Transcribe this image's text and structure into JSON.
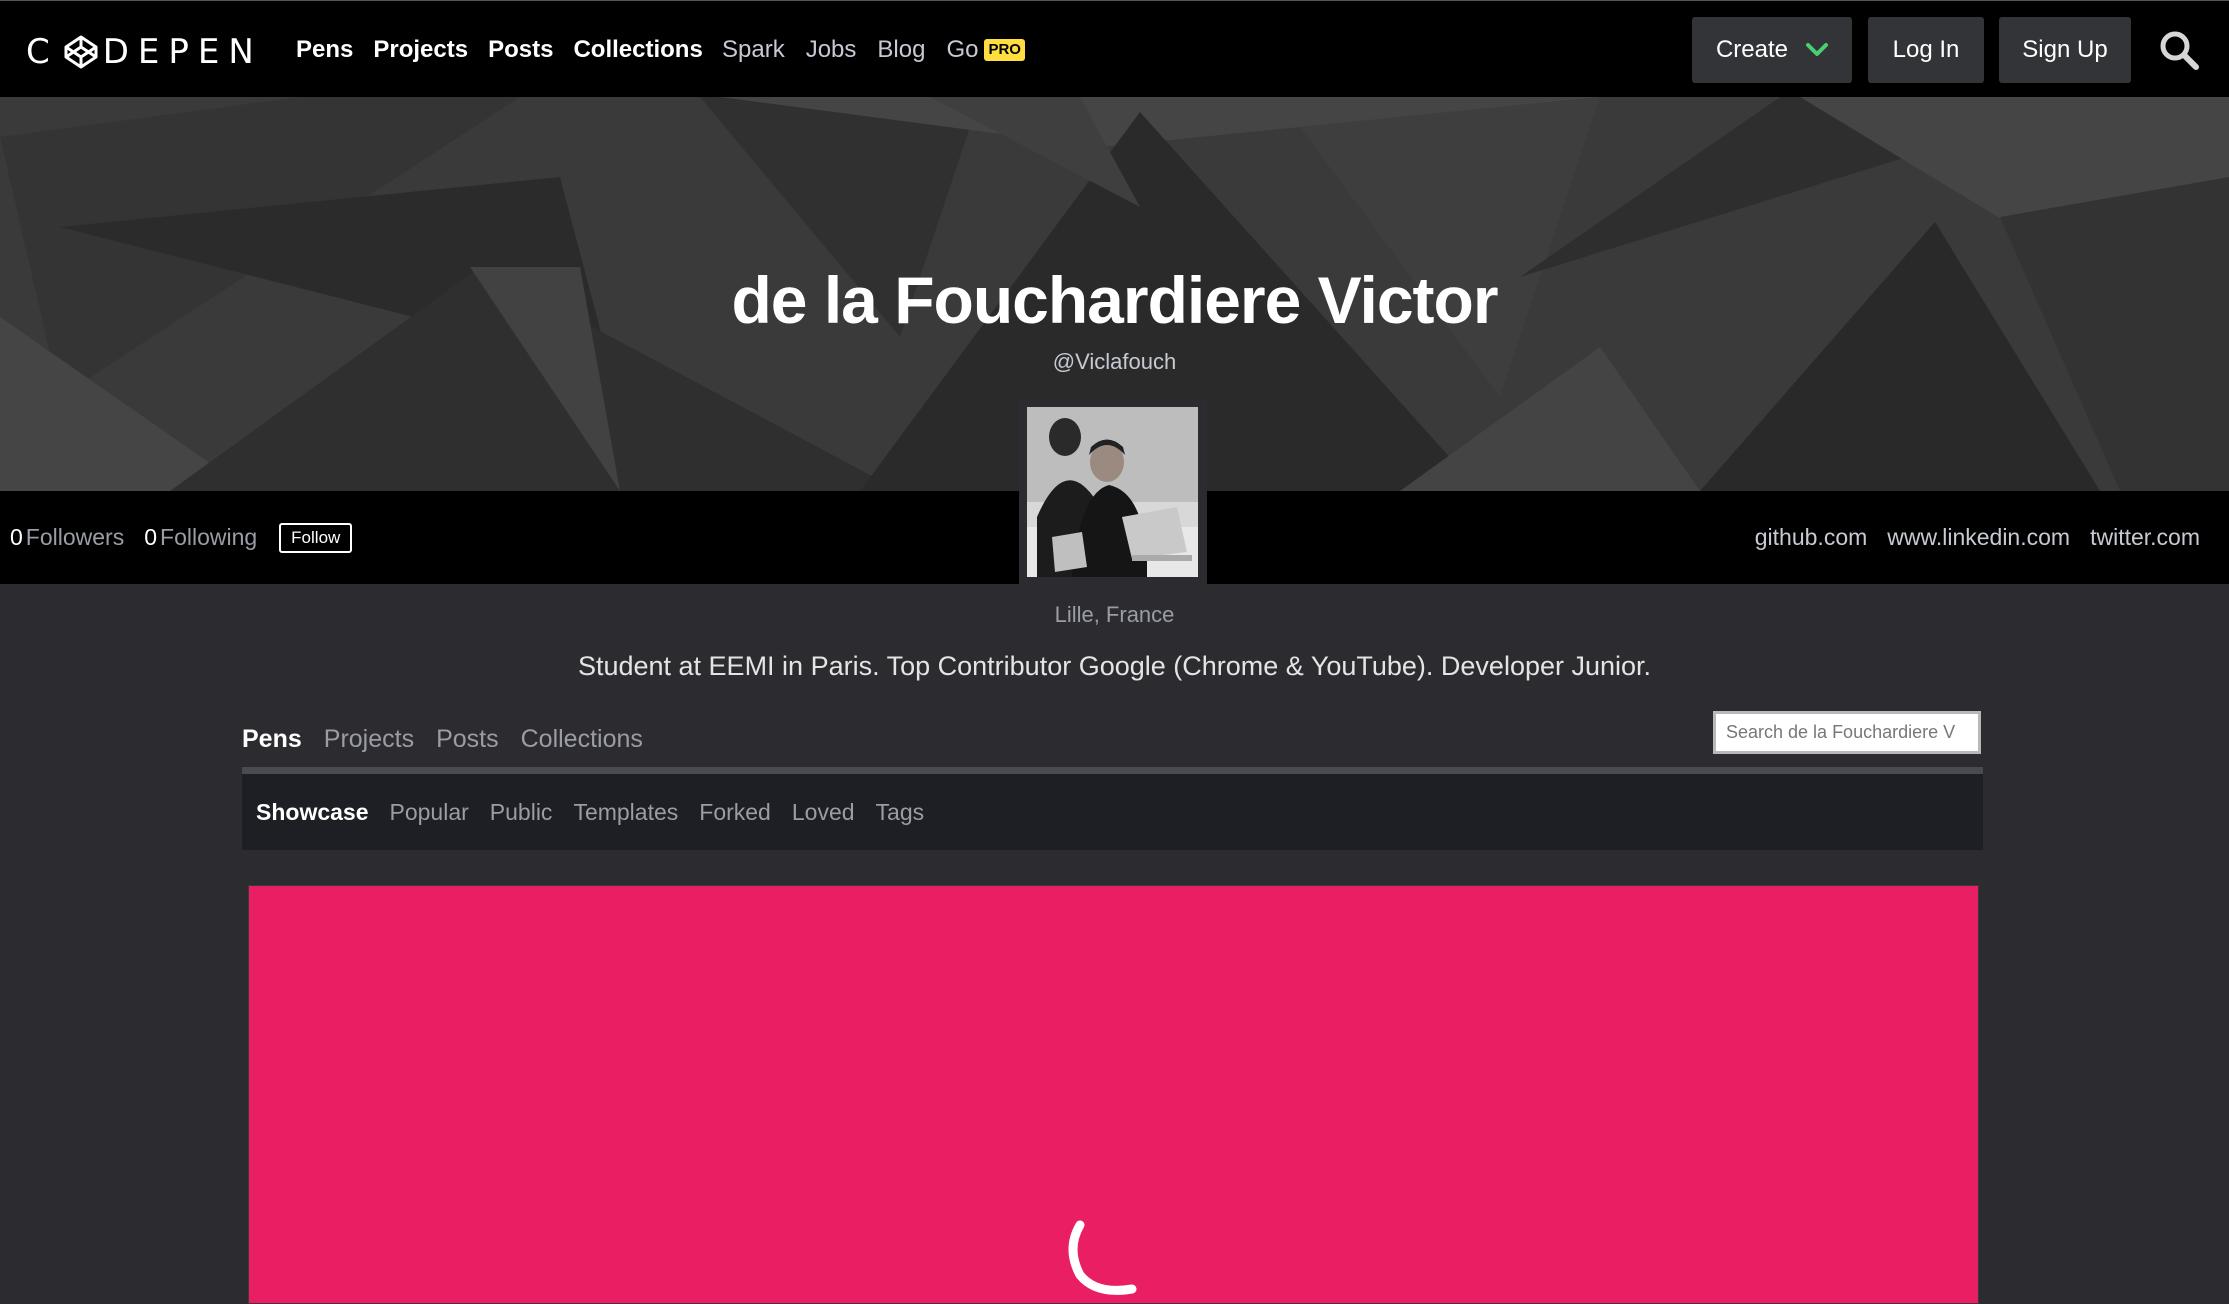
{
  "nav": {
    "logo_text_left": "C",
    "logo_text_right": "DEPEN",
    "primary": [
      "Pens",
      "Projects",
      "Posts",
      "Collections"
    ],
    "secondary": [
      "Spark",
      "Jobs",
      "Blog",
      "Go"
    ],
    "pro_badge": "PRO",
    "create_label": "Create",
    "login_label": "Log In",
    "signup_label": "Sign Up",
    "icons": {
      "search": "search-icon",
      "create_chevron": "chevron-down-icon",
      "logo": "codepen-logo-icon"
    },
    "accent": "#47cf73"
  },
  "profile": {
    "name": "de la Fouchardiere Victor",
    "handle": "@Viclafouch",
    "followers_count": "0",
    "followers_label": "Followers",
    "following_count": "0",
    "following_label": "Following",
    "follow_label": "Follow",
    "links": [
      "github.com",
      "www.linkedin.com",
      "twitter.com"
    ],
    "location": "Lille, France",
    "bio": "Student at EEMI in Paris. Top Contributor Google (Chrome & YouTube). Developer Junior."
  },
  "tabs": {
    "items": [
      "Pens",
      "Projects",
      "Posts",
      "Collections"
    ],
    "active": "Pens"
  },
  "search": {
    "placeholder": "Search de la Fouchardiere V"
  },
  "subtabs": {
    "items": [
      "Showcase",
      "Popular",
      "Public",
      "Templates",
      "Forked",
      "Loved",
      "Tags"
    ],
    "active": "Showcase"
  },
  "pen": {
    "background": "#ea1e63",
    "icon": "loading-spinner-icon"
  }
}
